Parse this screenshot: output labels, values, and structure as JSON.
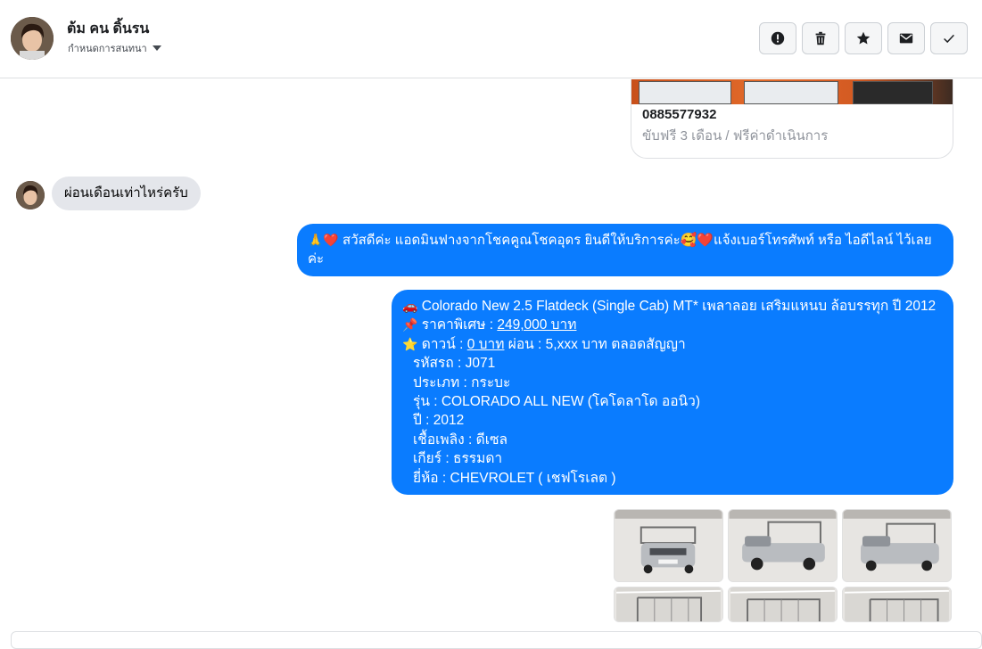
{
  "header": {
    "contact_name": "ต้ม คน ดิ้นรน",
    "subtitle": "กำหนดการสนทนา",
    "actions": [
      {
        "name": "report-button",
        "icon": "alert-icon"
      },
      {
        "name": "delete-button",
        "icon": "trash-icon"
      },
      {
        "name": "star-button",
        "icon": "star-icon"
      },
      {
        "name": "mark-unread-button",
        "icon": "envelope-icon"
      },
      {
        "name": "done-button",
        "icon": "check-icon"
      }
    ]
  },
  "card": {
    "phone": "0885577932",
    "description": "ขับฟรี 3 เดือน / ฟรีค่าดำเนินการ"
  },
  "incoming": {
    "text": "ผ่อนเดือนเท่าไหร่ครับ"
  },
  "reply1": {
    "emoji": "🙏❤️",
    "text": "สวัสดีค่ะ แอดมินฟางจากโชคคูณโชคอุดร ยินดีให้บริการค่ะ🥰❤️แจ้งเบอร์โทรศัพท์ หรือ ไอดีไลน์  ไว้เลยค่ะ"
  },
  "listing": {
    "title_icon": "🚗",
    "title": "Colorado New 2.5 Flatdeck (Single Cab) MT* เพลาลอย เสริมแหนบ ล้อบรรทุก  ปี 2012",
    "price_icon": "📌",
    "price_label": "ราคาพิเศษ : ",
    "price_value": "249,000 บาท",
    "down_icon": "⭐",
    "down_label": "ดาวน์ : ",
    "down_value": "0 บาท",
    "installment": " ผ่อน : 5,xxx บาท ตลอดสัญญา",
    "specs": [
      "รหัสรถ : J071",
      "ประเภท : กระบะ",
      "รุ่น : COLORADO ALL NEW (โคโดลาโด ออนิว)",
      "ปี : 2012",
      "เชื้อเพลิง : ดีเซล",
      "เกียร์ : ธรรมดา",
      "ยี่ห้อ : CHEVROLET ( เชฟโรเลต )"
    ]
  },
  "photos": [
    "car-front-photo",
    "car-side-photo",
    "car-angle-photo",
    "car-rack-photo-1",
    "car-rack-photo-2",
    "car-rack-photo-3"
  ],
  "colors": {
    "accent": "#0a7cff",
    "incoming_bubble": "#e4e6eb"
  }
}
